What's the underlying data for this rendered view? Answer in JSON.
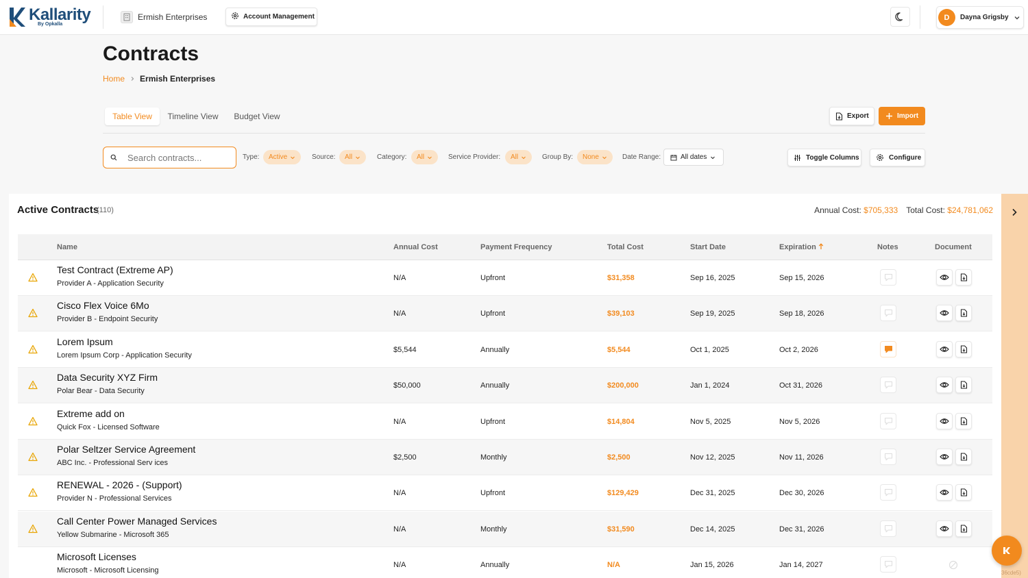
{
  "brand": {
    "name": "Kallarity",
    "sub": "By Opkalla"
  },
  "topbar": {
    "org_name": "Ermish Enterprises",
    "account_button": "Account Management",
    "user_initial": "D",
    "user_name": "Dayna Grigsby"
  },
  "colors": {
    "accent": "#f28a1e",
    "brand": "#1f4e7a",
    "accent_light": "#fbe3c8"
  },
  "page": {
    "title": "Contracts",
    "breadcrumb": {
      "home": "Home",
      "current": "Ermish Enterprises"
    }
  },
  "views": {
    "tabs": [
      "Table View",
      "Timeline View",
      "Budget View"
    ],
    "active": "Table View",
    "export_label": "Export",
    "import_label": "Import"
  },
  "filters": {
    "search_placeholder": "Search contracts...",
    "type": {
      "label": "Type:",
      "value": "Active"
    },
    "source": {
      "label": "Source:",
      "value": "All"
    },
    "category": {
      "label": "Category:",
      "value": "All"
    },
    "provider": {
      "label": "Service Provider:",
      "value": "All"
    },
    "group": {
      "label": "Group By:",
      "value": "None"
    },
    "date": {
      "label": "Date Range:",
      "value": "All dates"
    },
    "toggle_columns": "Toggle Columns",
    "configure": "Configure"
  },
  "panel": {
    "title": "Active Contracts",
    "count": "(110)",
    "annual_cost_label": "Annual Cost:",
    "annual_cost_value": "$705,333",
    "total_cost_label": "Total Cost:",
    "total_cost_value": "$24,781,062"
  },
  "table": {
    "columns": {
      "name": "Name",
      "annual": "Annual Cost",
      "freq": "Payment Frequency",
      "total": "Total Cost",
      "start": "Start Date",
      "expiration": "Expiration",
      "notes": "Notes",
      "document": "Document"
    },
    "sorted_by": "Expiration",
    "rows": [
      {
        "name": "Test Contract (Extreme AP)",
        "sub": "Provider A - Application Security",
        "annual": "N/A",
        "freq": "Upfront",
        "total": "$31,358",
        "start": "Sep 16, 2025",
        "exp": "Sep 15, 2026",
        "has_note": false,
        "has_doc": true,
        "warning": true
      },
      {
        "name": "Cisco Flex Voice 6Mo",
        "sub": "Provider B - Endpoint Security",
        "annual": "N/A",
        "freq": "Upfront",
        "total": "$39,103",
        "start": "Sep 19, 2025",
        "exp": "Sep 18, 2026",
        "has_note": false,
        "has_doc": true,
        "warning": true
      },
      {
        "name": "Lorem Ipsum",
        "sub": "Lorem Ipsum Corp - Application Security",
        "annual": "$5,544",
        "freq": "Annually",
        "total": "$5,544",
        "start": "Oct 1, 2025",
        "exp": "Oct 2, 2026",
        "has_note": true,
        "has_doc": true,
        "warning": true
      },
      {
        "name": "Data Security XYZ Firm",
        "sub": "Polar Bear - Data Security",
        "annual": "$50,000",
        "freq": "Annually",
        "total": "$200,000",
        "start": "Jan 1, 2024",
        "exp": "Oct 31, 2026",
        "has_note": false,
        "has_doc": true,
        "warning": true
      },
      {
        "name": "Extreme add on",
        "sub": "Quick Fox - Licensed Software",
        "annual": "N/A",
        "freq": "Upfront",
        "total": "$14,804",
        "start": "Nov 5, 2025",
        "exp": "Nov 5, 2026",
        "has_note": false,
        "has_doc": true,
        "warning": true
      },
      {
        "name": "Polar Seltzer Service Agreement",
        "sub": "ABC Inc. - Professional Serv ices",
        "annual": "$2,500",
        "freq": "Monthly",
        "total": "$2,500",
        "start": "Nov 12, 2025",
        "exp": "Nov 11, 2026",
        "has_note": false,
        "has_doc": true,
        "warning": true
      },
      {
        "name": "RENEWAL - 2026 - (Support)",
        "sub": "Provider N - Professional Services",
        "annual": "N/A",
        "freq": "Upfront",
        "total": "$129,429",
        "start": "Dec 31, 2025",
        "exp": "Dec 30, 2026",
        "has_note": false,
        "has_doc": true,
        "warning": true
      },
      {
        "name": "Call Center Power Managed Services",
        "sub": "Yellow Submarine - Microsoft 365",
        "annual": "N/A",
        "freq": "Monthly",
        "total": "$31,590",
        "start": "Dec 14, 2025",
        "exp": "Dec 31, 2026",
        "has_note": false,
        "has_doc": true,
        "warning": true
      },
      {
        "name": "Microsoft Licenses",
        "sub": "Microsoft - Microsoft Licensing",
        "annual": "N/A",
        "freq": "Annually",
        "total": "N/A",
        "start": "Jan 15, 2026",
        "exp": "Jan 14, 2027",
        "has_note": false,
        "has_doc": false,
        "warning": false
      }
    ]
  },
  "build_tag": "36cde5)"
}
